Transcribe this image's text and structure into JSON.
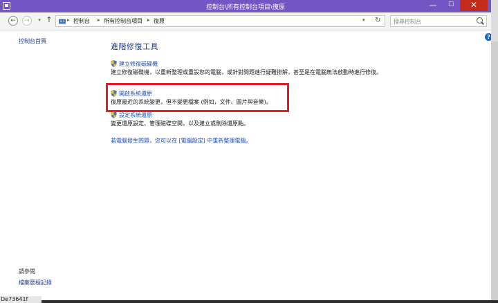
{
  "window": {
    "title": "控制台\\所有控制台項目\\復原",
    "minimize": "—",
    "maximize": "☐",
    "close": "✕"
  },
  "nav": {
    "back": "←",
    "forward": "→",
    "recent": "▾",
    "up": "↑",
    "address_crumbs": [
      "控制台",
      "所有控制台項目",
      "復原"
    ],
    "address_sep": "▸",
    "address_dropdown": "▾",
    "refresh": "↻",
    "search_placeholder": "搜尋控制台"
  },
  "sidebar": {
    "home": "控制台首頁",
    "see_also": "請參閱",
    "file_history": "檔案歷程記錄"
  },
  "main": {
    "heading": "進階修復工具",
    "tasks": [
      {
        "link": "建立修復磁碟機",
        "desc": "建立修復磁碟機，以重新整理或重設您的電腦，或針對問題進行疑難排解，甚至是在電腦無法啟動時進行修復。"
      },
      {
        "link": "開啟系統還原",
        "desc": "復原最近的系統變更，但不變更檔案 (例如，文件、圖片與音樂)。"
      },
      {
        "link": "設定系統還原",
        "desc": "變更還原設定、管理磁碟空間，以及建立或刪除還原點。"
      }
    ],
    "bottom_link": "若電腦發生問題，您可以在 [電腦設定] 中重新整理電腦。",
    "help": "?"
  },
  "taskbar": {
    "text": "De73641f"
  },
  "colors": {
    "window_frame": "#7356c4",
    "link": "#1e4fbf",
    "heading": "#1e3a8c",
    "highlight_box": "#e2202a",
    "close_button": "#c42b1c"
  }
}
